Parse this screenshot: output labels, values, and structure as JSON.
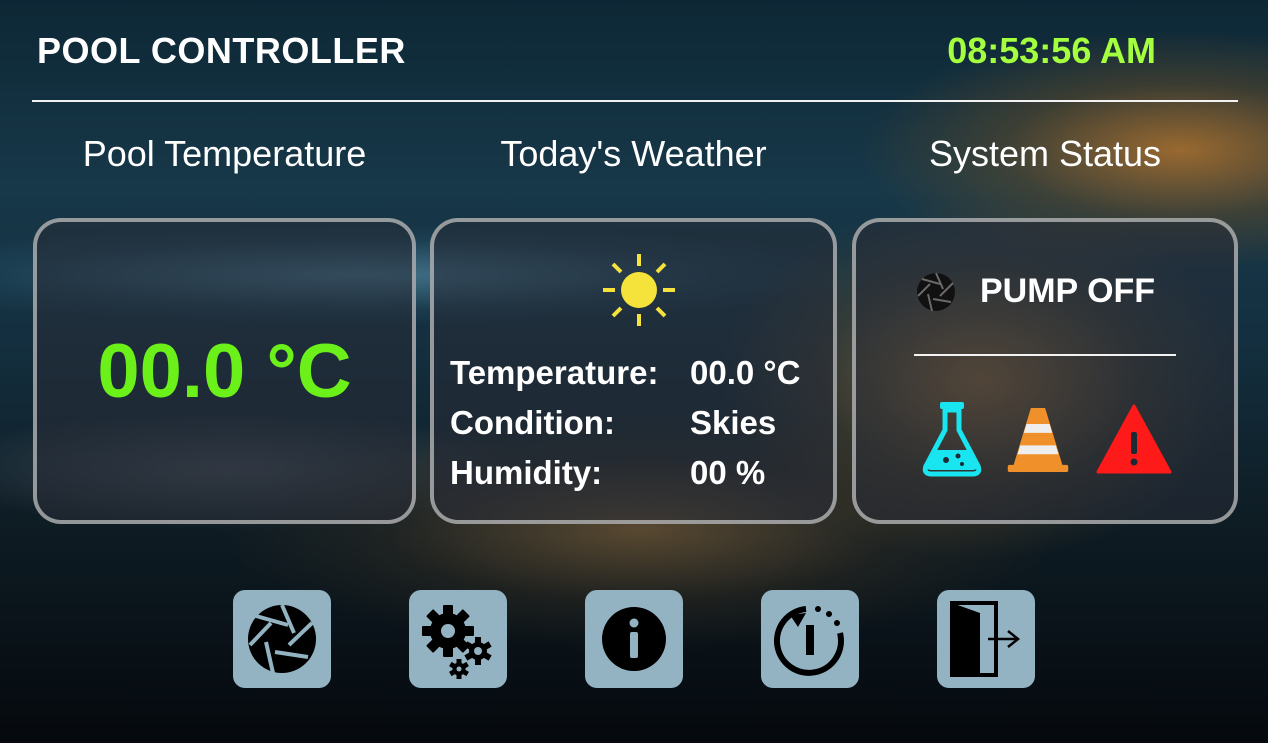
{
  "header": {
    "title": "POOL CONTROLLER",
    "clock": "08:53:56 AM"
  },
  "sections": {
    "pool_heading": "Pool Temperature",
    "weather_heading": "Today's Weather",
    "status_heading": "System Status"
  },
  "pool": {
    "temperature": "00.0 °C"
  },
  "weather": {
    "icon": "sun-icon",
    "temperature_label": "Temperature:",
    "temperature_value": "00.0 °C",
    "condition_label": "Condition:",
    "condition_value": "Skies",
    "humidity_label": "Humidity:",
    "humidity_value": "00 %"
  },
  "status": {
    "pump_icon": "aperture-icon",
    "pump_label": "PUMP OFF",
    "indicators": [
      {
        "icon": "flask-icon",
        "color": "#19e5f0"
      },
      {
        "icon": "traffic-cone-icon",
        "color": "#f0902a"
      },
      {
        "icon": "warning-triangle-icon",
        "color": "#ff1a1a"
      }
    ]
  },
  "nav": [
    {
      "icon": "aperture-icon"
    },
    {
      "icon": "gears-icon"
    },
    {
      "icon": "info-icon"
    },
    {
      "icon": "timer-restart-icon"
    },
    {
      "icon": "exit-door-icon"
    }
  ],
  "colors": {
    "clock": "#a4ff3e",
    "pool_temperature": "#6cf01a",
    "nav_button": "#93b3c3",
    "sun": "#f5e23a"
  }
}
